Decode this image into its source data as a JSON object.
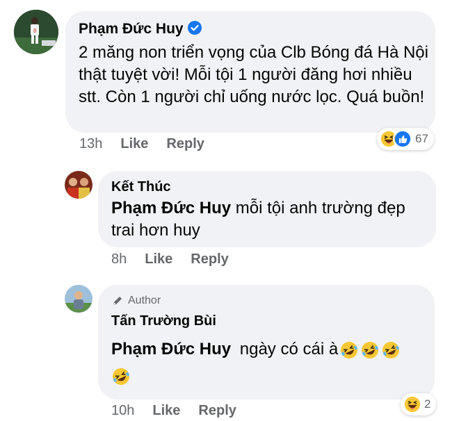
{
  "comment1": {
    "author": "Phạm Đức Huy",
    "verified_icon": "verified-badge-icon",
    "text": "2 măng non triển vọng của Clb Bóng đá Hà Nội thật tuyệt vời! Mỗi tội 1 người đăng hơi nhiều stt. Còn 1 người chỉ uống nước lọc. Quá buồn!",
    "time": "13h",
    "like_label": "Like",
    "reply_label": "Reply",
    "reaction_count": "67",
    "reaction_icons": [
      "haha-icon",
      "like-icon"
    ]
  },
  "reply1": {
    "author": "Kết Thúc",
    "mention": "Phạm Đức Huy",
    "text": " mỗi tội anh trường đẹp trai hơn huy",
    "time": "8h",
    "like_label": "Like",
    "reply_label": "Reply"
  },
  "reply2": {
    "badge_label": "Author",
    "badge_icon": "pencil-icon",
    "author": "Tấn Trường Bùi",
    "mention": "Phạm Đức Huy",
    "text": " ngày có cái à",
    "emoji": "rofl-emoji",
    "time": "10h",
    "like_label": "Like",
    "reply_label": "Reply",
    "reaction_count": "2",
    "reaction_icons": [
      "haha-icon"
    ]
  },
  "colors": {
    "bubble": "#f0f2f5",
    "meta_text": "#65676b",
    "verified_blue": "#1877f2",
    "like_blue": "#1877f2"
  }
}
